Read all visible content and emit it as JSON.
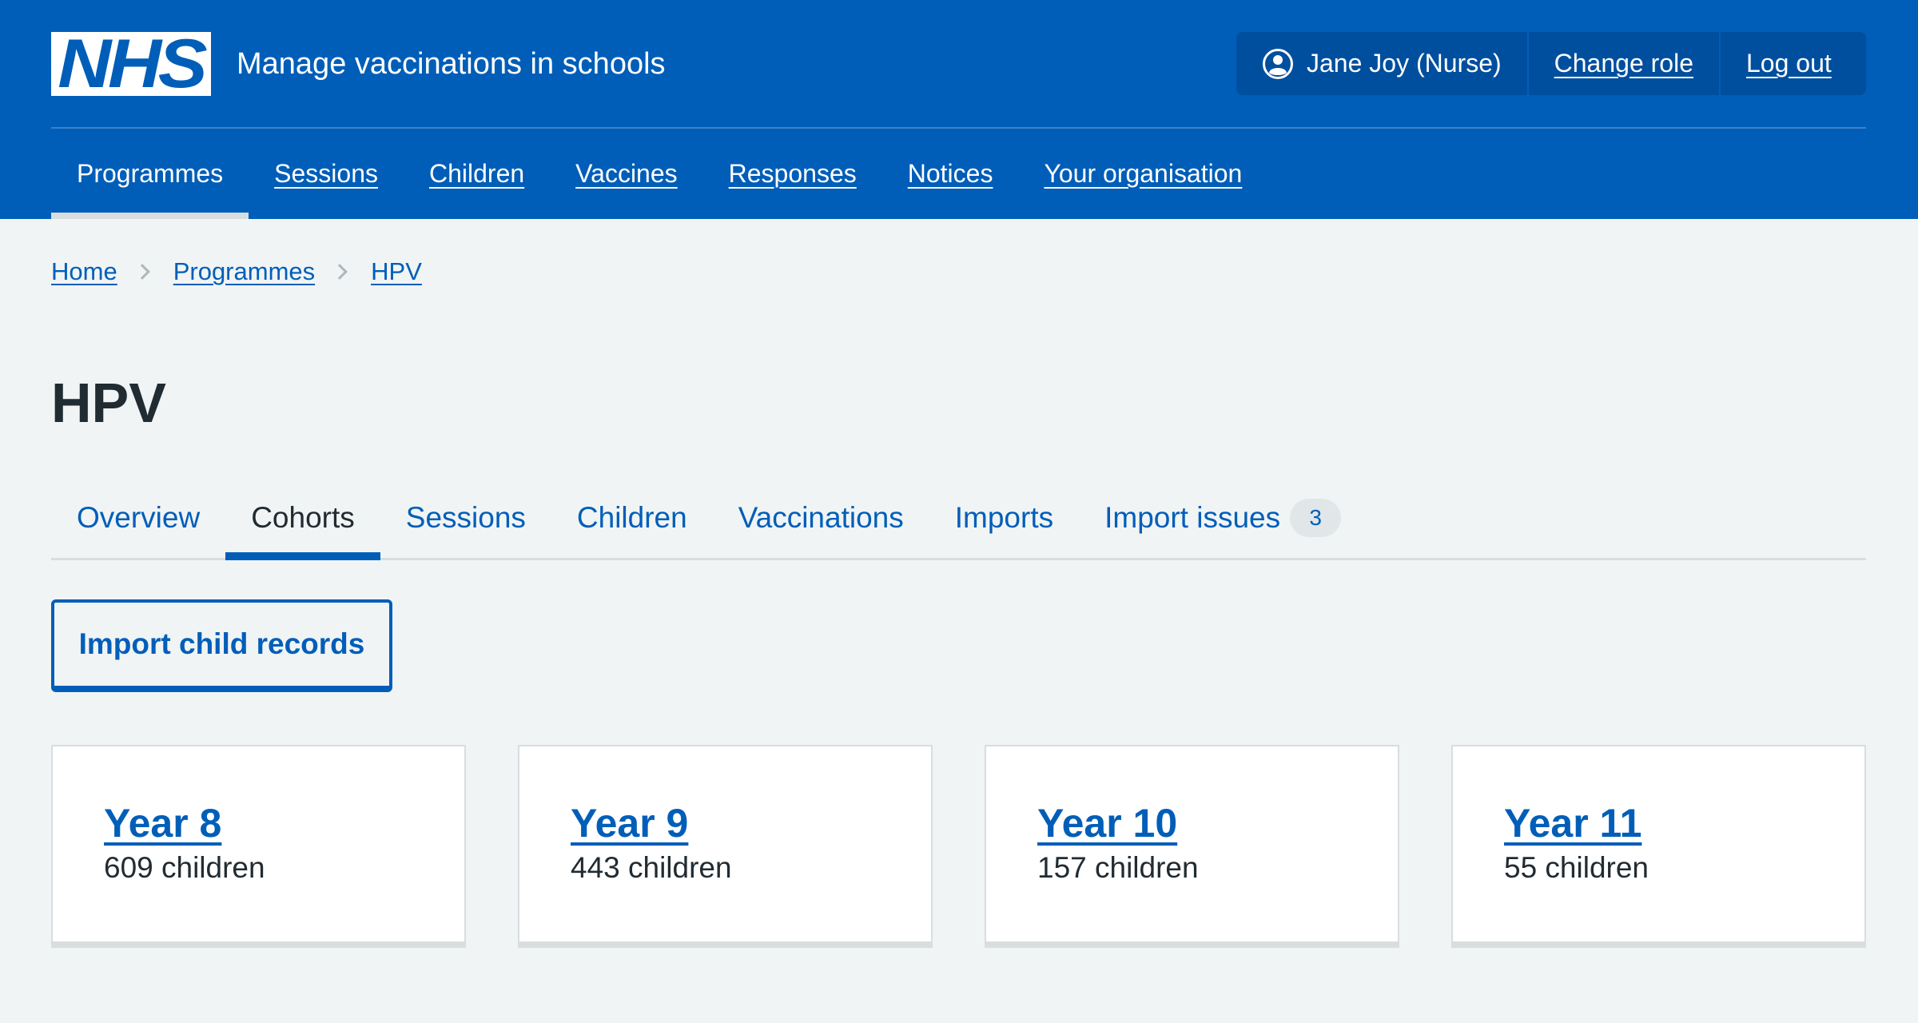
{
  "header": {
    "logo_text": "NHS",
    "service_name": "Manage vaccinations in schools",
    "account": {
      "user_label": "Jane Joy (Nurse)",
      "change_role_label": "Change role",
      "log_out_label": "Log out",
      "user_icon": "user-circle-icon"
    },
    "nav": [
      {
        "label": "Programmes",
        "active": true
      },
      {
        "label": "Sessions",
        "active": false
      },
      {
        "label": "Children",
        "active": false
      },
      {
        "label": "Vaccines",
        "active": false
      },
      {
        "label": "Responses",
        "active": false
      },
      {
        "label": "Notices",
        "active": false
      },
      {
        "label": "Your organisation",
        "active": false
      }
    ]
  },
  "breadcrumb": [
    {
      "label": "Home"
    },
    {
      "label": "Programmes"
    },
    {
      "label": "HPV"
    }
  ],
  "page": {
    "title": "HPV",
    "tabs": [
      {
        "label": "Overview",
        "active": false
      },
      {
        "label": "Cohorts",
        "active": true
      },
      {
        "label": "Sessions",
        "active": false
      },
      {
        "label": "Children",
        "active": false
      },
      {
        "label": "Vaccinations",
        "active": false
      },
      {
        "label": "Imports",
        "active": false
      },
      {
        "label": "Import issues",
        "active": false,
        "badge": "3"
      }
    ],
    "import_button_label": "Import child records",
    "cohorts": [
      {
        "title": "Year 8",
        "count": "609 children"
      },
      {
        "title": "Year 9",
        "count": "443 children"
      },
      {
        "title": "Year 10",
        "count": "157 children"
      },
      {
        "title": "Year 11",
        "count": "55 children"
      }
    ]
  },
  "colors": {
    "brand_blue": "#005eb8",
    "text_dark": "#212b32",
    "background": "#f0f4f5",
    "border_grey": "#d8dde0"
  }
}
